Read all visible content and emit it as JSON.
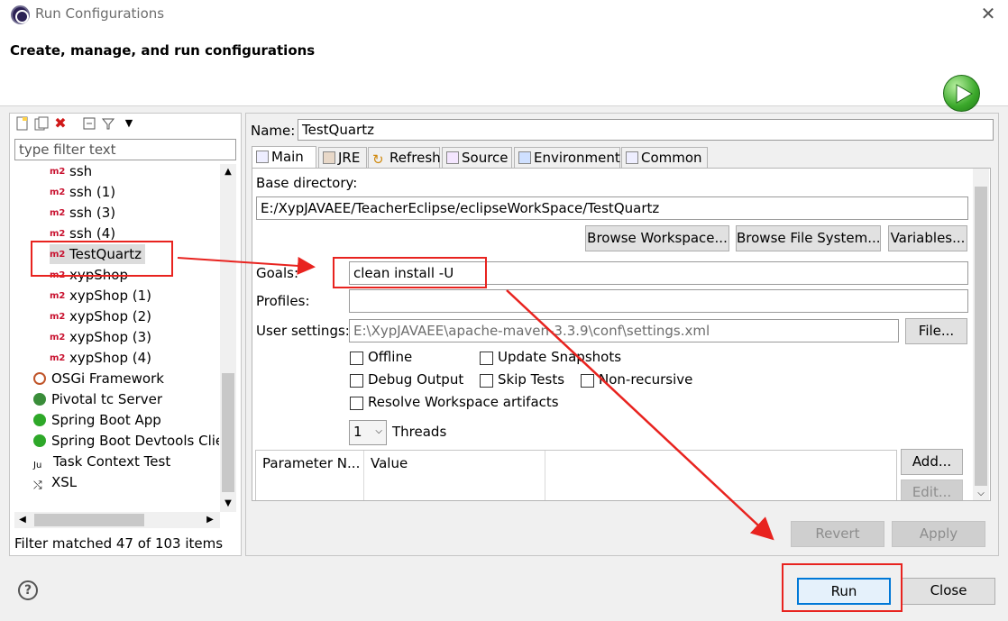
{
  "window": {
    "title": "Run Configurations",
    "close_glyph": "✕"
  },
  "header": {
    "title": "Create, manage, and run configurations"
  },
  "left": {
    "filter_placeholder": "type filter text",
    "items": [
      {
        "label": "ssh",
        "icon": "m2"
      },
      {
        "label": "ssh (1)",
        "icon": "m2"
      },
      {
        "label": "ssh (3)",
        "icon": "m2"
      },
      {
        "label": "ssh (4)",
        "icon": "m2"
      },
      {
        "label": "TestQuartz",
        "icon": "m2",
        "selected": true
      },
      {
        "label": "xypShop",
        "icon": "m2"
      },
      {
        "label": "xypShop (1)",
        "icon": "m2"
      },
      {
        "label": "xypShop (2)",
        "icon": "m2"
      },
      {
        "label": "xypShop (3)",
        "icon": "m2"
      },
      {
        "label": "xypShop (4)",
        "icon": "m2"
      },
      {
        "label": "OSGi Framework",
        "icon": "osgi"
      },
      {
        "label": "Pivotal tc Server",
        "icon": "pivotal"
      },
      {
        "label": "Spring Boot App",
        "icon": "spring"
      },
      {
        "label": "Spring Boot Devtools Clie",
        "icon": "spring-dev"
      },
      {
        "label": "Task Context Test",
        "icon": "ju"
      },
      {
        "label": "XSL",
        "icon": "xsl"
      }
    ],
    "status": "Filter matched 47 of 103 items",
    "m2_glyph": "m2"
  },
  "right": {
    "name_label": "Name:",
    "name_value": "TestQuartz",
    "tabs": [
      {
        "label": "Main"
      },
      {
        "label": "JRE"
      },
      {
        "label": "Refresh"
      },
      {
        "label": "Source"
      },
      {
        "label": "Environment"
      },
      {
        "label": "Common"
      }
    ],
    "base_dir_label": "Base directory:",
    "base_dir_value": "E:/XypJAVAEE/TeacherEclipse/eclipseWorkSpace/TestQuartz",
    "browse_workspace": "Browse Workspace...",
    "browse_fs": "Browse File System...",
    "variables": "Variables...",
    "goals_label": "Goals:",
    "goals_value": "clean install -U",
    "profiles_label": "Profiles:",
    "profiles_value": "",
    "user_settings_label": "User settings:",
    "user_settings_value": "E:\\XypJAVAEE\\apache-maven-3.3.9\\conf\\settings.xml",
    "file_button": "File...",
    "offline": "Offline",
    "update_snapshots": "Update Snapshots",
    "debug_output": "Debug Output",
    "skip_tests": "Skip Tests",
    "non_recursive": "Non-recursive",
    "resolve_ws": "Resolve Workspace artifacts",
    "threads_value": "1",
    "threads_label": "Threads",
    "param_col": "Parameter N...",
    "value_col": "Value",
    "add_button": "Add...",
    "edit_button": "Edit...",
    "revert_button": "Revert",
    "apply_button": "Apply"
  },
  "footer": {
    "help_glyph": "?",
    "run_button": "Run",
    "close_button": "Close"
  },
  "colors": {
    "annotation": "#e8231f",
    "focus": "#0078d7"
  }
}
